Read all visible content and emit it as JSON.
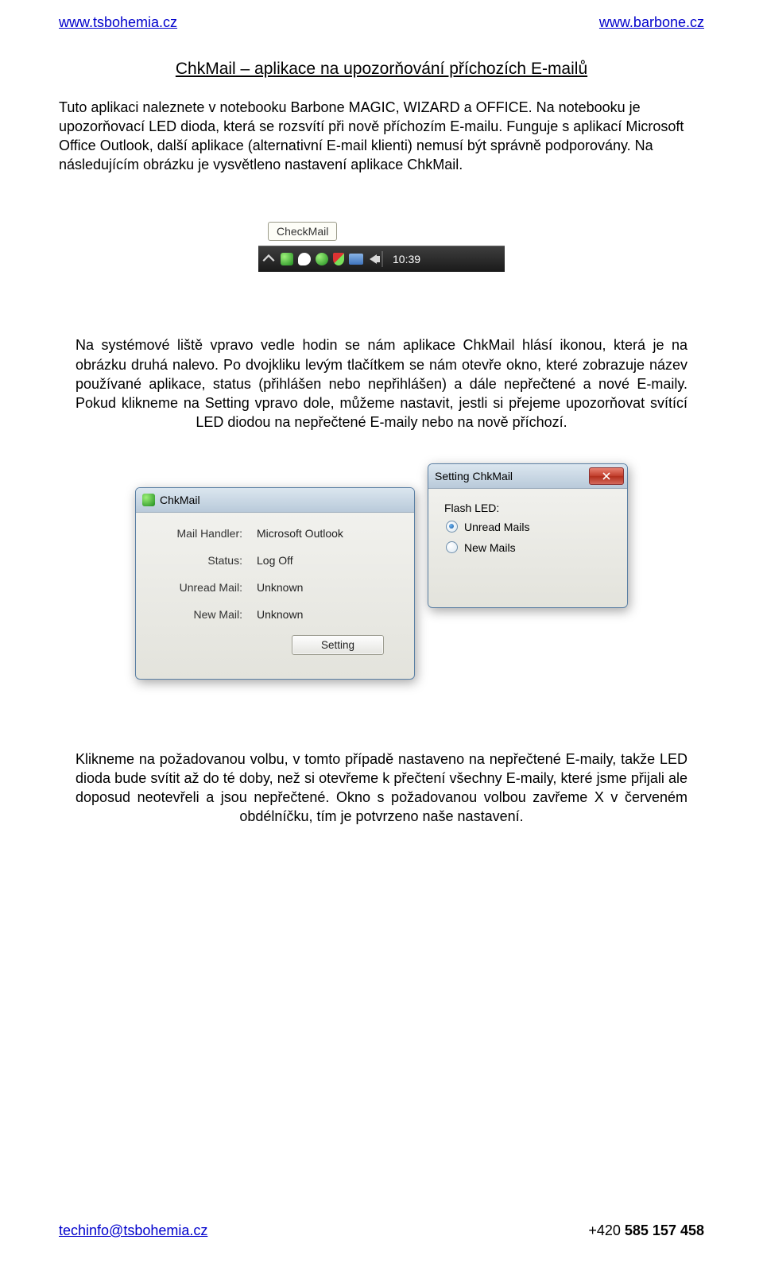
{
  "header": {
    "left_link": "www.tsbohemia.cz",
    "right_link": "www.barbone.cz"
  },
  "title": "ChkMail – aplikace na upozorňování příchozích E-mailů",
  "para1": "Tuto aplikaci naleznete v notebooku Barbone MAGIC, WIZARD a OFFICE. Na notebooku je upozorňovací LED dioda, která se rozsvítí  při nově příchozím E-mailu. Funguje s aplikací Microsoft Office Outlook, další aplikace (alternativní E-mail klienti) nemusí být správně podporovány. Na následujícím obrázku je vysvětleno nastavení aplikace ChkMail.",
  "taskbar": {
    "tooltip": "CheckMail",
    "clock": "10:39"
  },
  "para2": "Na systémové liště vpravo vedle hodin se nám aplikace ChkMail hlásí ikonou, která je na obrázku druhá nalevo. Po dvojkliku levým tlačítkem se nám otevře okno, které zobrazuje název používané aplikace, status (přihlášen nebo nepřihlášen) a dále nepřečtené a nové E-maily. Pokud klikneme na Setting vpravo dole, můžeme nastavit, jestli si přejeme upozorňovat svítící LED diodou na nepřečtené E-maily nebo na nově příchozí.",
  "main_window": {
    "title": "ChkMail",
    "rows": {
      "mail_handler_label": "Mail Handler:",
      "mail_handler_value": "Microsoft Outlook",
      "status_label": "Status:",
      "status_value": "Log Off",
      "unread_label": "Unread Mail:",
      "unread_value": "Unknown",
      "new_label": "New Mail:",
      "new_value": "Unknown"
    },
    "setting_btn": "Setting"
  },
  "setting_window": {
    "title": "Setting ChkMail",
    "section_label": "Flash LED:",
    "opt_unread": "Unread Mails",
    "opt_new": "New Mails"
  },
  "para3": "Klikneme na požadovanou volbu, v tomto případě nastaveno na nepřečtené E-maily, takže LED dioda bude svítit až do té doby, než si otevřeme k přečtení všechny E-maily, které jsme přijali ale doposud neotevřeli a jsou nepřečtené. Okno s požadovanou volbou zavřeme X v červeném obdélníčku, tím je potvrzeno naše nastavení.",
  "footer": {
    "email": "techinfo@tsbohemia.cz",
    "phone_prefix": "+420 ",
    "phone_bold": "585 157 458"
  }
}
